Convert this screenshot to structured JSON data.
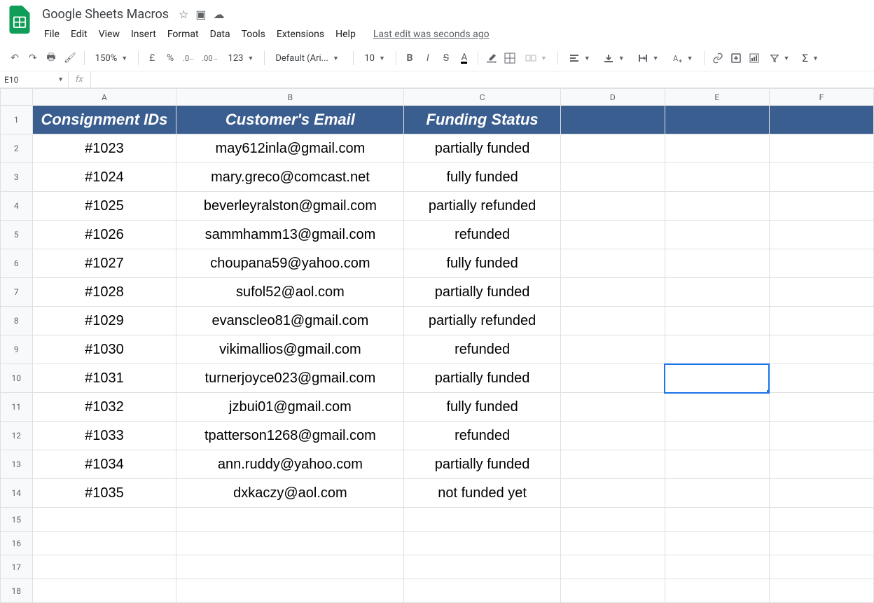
{
  "doc": {
    "title": "Google Sheets Macros"
  },
  "menubar": {
    "file": "File",
    "edit": "Edit",
    "view": "View",
    "insert": "Insert",
    "format": "Format",
    "data": "Data",
    "tools": "Tools",
    "extensions": "Extensions",
    "help": "Help",
    "last_edit": "Last edit was seconds ago"
  },
  "toolbar": {
    "zoom": "150%",
    "currency": "£",
    "percent": "%",
    "dec_dec": ".0",
    "inc_dec": ".00",
    "more_fmt": "123",
    "font": "Default (Ari...",
    "font_size": "10",
    "bold": "B",
    "italic": "I",
    "strike": "S",
    "text_color": "A"
  },
  "name_box": {
    "value": "E10"
  },
  "formula": {
    "fx": "fx",
    "value": ""
  },
  "columns": [
    "A",
    "B",
    "C",
    "D",
    "E",
    "F"
  ],
  "rows": [
    "1",
    "2",
    "3",
    "4",
    "5",
    "6",
    "7",
    "8",
    "9",
    "10",
    "11",
    "12",
    "13",
    "14",
    "15",
    "16",
    "17",
    "18"
  ],
  "active_cell": "E10",
  "data": {
    "header": {
      "A": "Consignment IDs",
      "B": "Customer's Email",
      "C": "Funding Status"
    },
    "body": [
      {
        "A": "#1023",
        "B": "may612inla@gmail.com",
        "C": "partially funded"
      },
      {
        "A": "#1024",
        "B": "mary.greco@comcast.net",
        "C": "fully funded"
      },
      {
        "A": "#1025",
        "B": "beverleyralston@gmail.com",
        "C": "partially refunded"
      },
      {
        "A": "#1026",
        "B": "sammhamm13@gmail.com",
        "C": "refunded"
      },
      {
        "A": "#1027",
        "B": "choupana59@yahoo.com",
        "C": "fully funded"
      },
      {
        "A": "#1028",
        "B": "sufol52@aol.com",
        "C": "partially funded"
      },
      {
        "A": "#1029",
        "B": "evanscleo81@gmail.com",
        "C": "partially refunded"
      },
      {
        "A": "#1030",
        "B": "vikimallios@gmail.com",
        "C": "refunded"
      },
      {
        "A": "#1031",
        "B": "turnerjoyce023@gmail.com",
        "C": "partially funded"
      },
      {
        "A": "#1032",
        "B": "jzbui01@gmail.com",
        "C": "fully funded"
      },
      {
        "A": "#1033",
        "B": "tpatterson1268@gmail.com",
        "C": "refunded"
      },
      {
        "A": "#1034",
        "B": "ann.ruddy@yahoo.com",
        "C": "partially funded"
      },
      {
        "A": "#1035",
        "B": "dxkaczy@aol.com",
        "C": "not funded yet"
      }
    ]
  }
}
